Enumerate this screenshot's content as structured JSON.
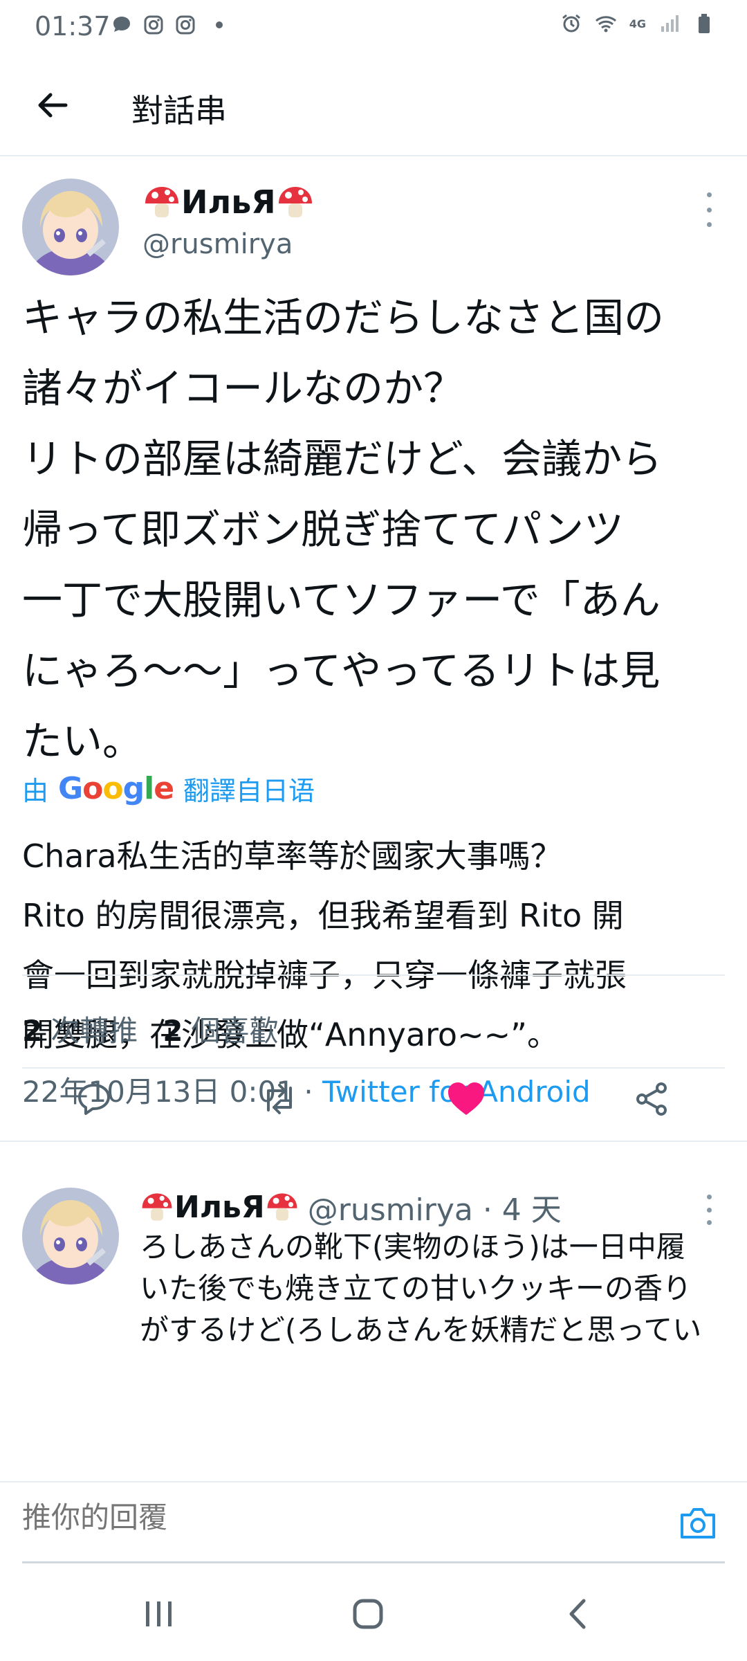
{
  "status_bar": {
    "time": "01:37",
    "network": "4G"
  },
  "header": {
    "title": "對話串"
  },
  "tweet": {
    "author_name": "ИльЯ",
    "author_handle": "@rusmirya",
    "text": "キャラの私生活のだらしなさと国の\n諸々がイコールなのか？\nリトの部屋は綺麗だけど、会議から\n帰って即ズボン脱ぎ捨ててパンツ\n一丁で大股開いてソファーで「あん\nにゃろ〜〜」ってやってるリトは見\nたい。",
    "translation_prefix": "由",
    "translation_brand": "Google",
    "translation_suffix": "翻譯自日语",
    "translated_text": "Chara私生活的草率等於國家大事嗎？\nRito 的房間很漂亮，但我希望看到 Rito 開\n會一回到家就脫掉褲子，只穿一條褲子就張\n開雙腿，在沙發上做“Annyaro~~”。",
    "timestamp": "22年10月13日 0:01 · ",
    "source": "Twitter for Android",
    "retweets_count": "2",
    "retweets_label": "次轉推",
    "likes_count": "2",
    "likes_label": "個喜歡",
    "liked": true
  },
  "reply": {
    "author_name": "ИльЯ",
    "author_handle": "@rusmirya · 4 天",
    "text": "ろしあさんの靴下(実物のほう)は一日中履\nいた後でも焼き立ての甘いクッキーの香り\nがするけど(ろしあさんを妖精だと思ってい"
  },
  "reply_box": {
    "placeholder": "推你的回覆"
  },
  "colors": {
    "accent": "#1d9bf0",
    "like": "#f91880"
  }
}
